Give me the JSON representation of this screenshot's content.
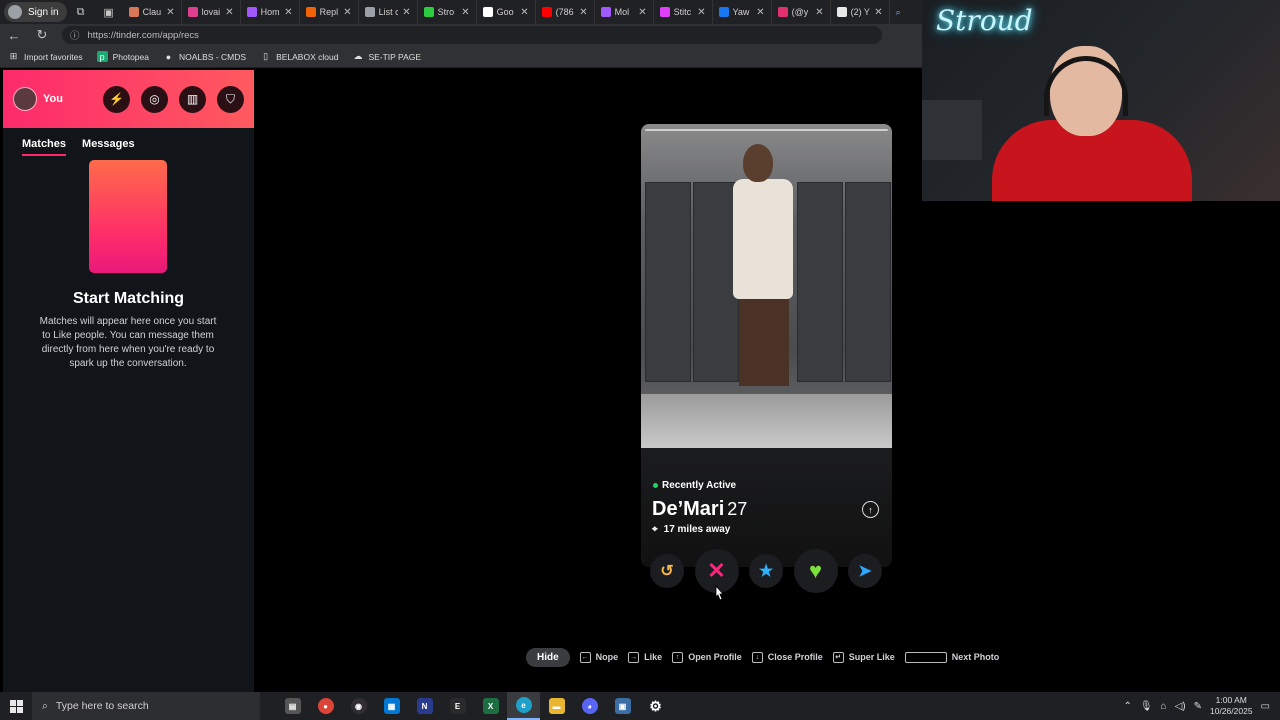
{
  "browser": {
    "signin_label": "Sign in",
    "tabs": [
      {
        "label": "Clau",
        "color": "#d97757"
      },
      {
        "label": "lovai",
        "color": "#e03e8f"
      },
      {
        "label": "Hom",
        "color": "#a259ff"
      },
      {
        "label": "Repl",
        "color": "#f26207"
      },
      {
        "label": "List c",
        "color": "#9aa0a6"
      },
      {
        "label": "Stro",
        "color": "#2ecc40"
      },
      {
        "label": "Goo",
        "color": "#ffffff"
      },
      {
        "label": "(786",
        "color": "#ff0000"
      },
      {
        "label": "Mol",
        "color": "#a259ff"
      },
      {
        "label": "Stitc",
        "color": "#e040fb"
      },
      {
        "label": "Yaw",
        "color": "#1877f2"
      },
      {
        "label": "(@y",
        "color": "#e1306c"
      },
      {
        "label": "(2) Y",
        "color": "#e8e8e8"
      }
    ],
    "url": "https://tinder.com/app/recs",
    "bookmarks": [
      "Import favorites",
      "Photopea",
      "NOALBS - CMDS",
      "BELABOX cloud",
      "SE-TIP PAGE"
    ]
  },
  "sidebar": {
    "user_label": "You",
    "tabs": {
      "matches": "Matches",
      "messages": "Messages"
    },
    "empty_title": "Start Matching",
    "empty_text": "Matches will appear here once you start to Like people. You can message them directly from here when you're ready to spark up the conversation."
  },
  "card": {
    "status": "Recently Active",
    "name": "De’Mari",
    "age": "27",
    "distance": "17 miles away"
  },
  "hints": {
    "hide": "Hide",
    "nope": "Nope",
    "like": "Like",
    "open_profile": "Open Profile",
    "close_profile": "Close Profile",
    "super_like": "Super Like",
    "next_photo": "Next Photo"
  },
  "taskbar": {
    "search_placeholder": "Type here to search",
    "time": "1:00 AM",
    "date": "10/26/2025"
  },
  "webcam": {
    "neon_text": "Stroud"
  },
  "colors": {
    "brand": "#fd2a6b",
    "rewind": "#f5b748",
    "nope": "#fd267d",
    "superlike": "#2db3fe",
    "like": "#7ae03a",
    "boost": "#2ea8ff"
  }
}
